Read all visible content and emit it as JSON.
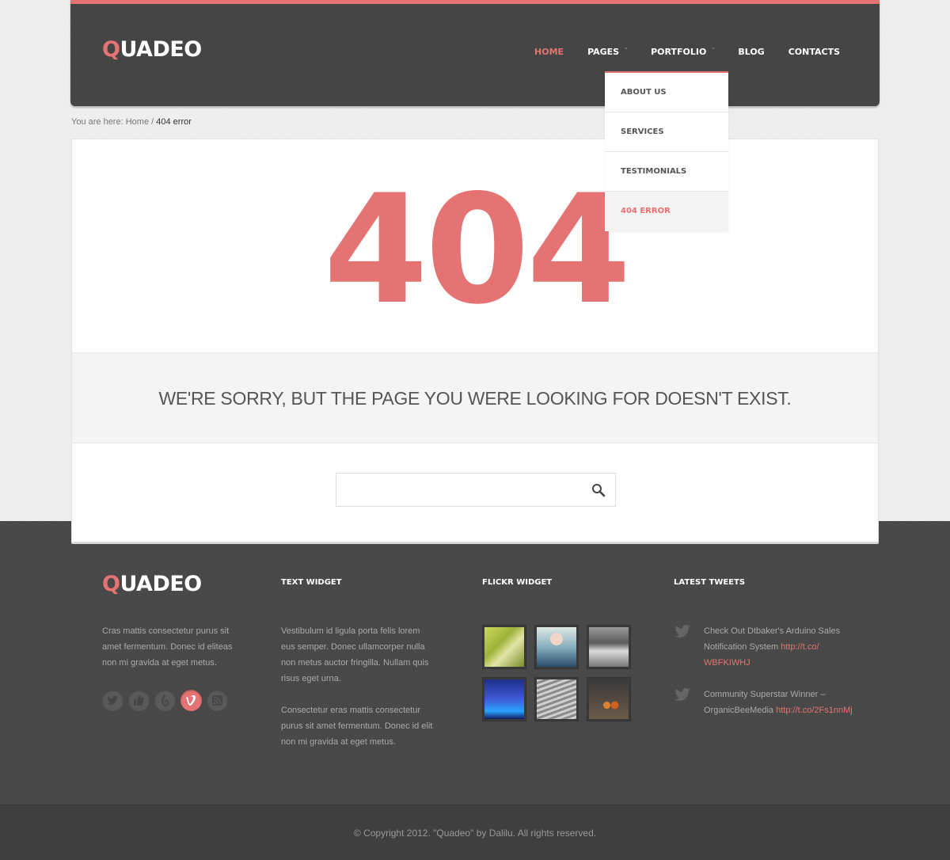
{
  "header": {
    "logo_first": "Q",
    "logo_rest": "UADEO",
    "nav": [
      {
        "label": "HOME"
      },
      {
        "label": "PAGES"
      },
      {
        "label": "PORTFOLIO"
      },
      {
        "label": "BLOG"
      },
      {
        "label": "CONTACTS"
      }
    ],
    "dropdown": [
      {
        "label": "ABOUT US"
      },
      {
        "label": "SERVICES"
      },
      {
        "label": "TESTIMONIALS"
      },
      {
        "label": "404 ERROR"
      }
    ],
    "active_nav": "HOME",
    "accent_color": "#e57373"
  },
  "breadcrumb": {
    "prefix": "You are here:",
    "home": "Home",
    "separator": "/",
    "current": "404 error"
  },
  "main": {
    "error_code": "404",
    "message": "WE'RE SORRY, BUT THE PAGE YOU WERE LOOKING FOR DOESN'T EXIST.",
    "search_placeholder": "",
    "search_icon": "search-icon"
  },
  "footer": {
    "logo_first": "Q",
    "logo_rest": "UADEO",
    "about_text": "Cras mattis consectetur purus sit amet fermentum. Donec id eliteas non mi gravida at eget metus.",
    "social_icons": [
      "twitter-icon",
      "like-icon",
      "dribbble-icon",
      "vimeo-icon",
      "rss-icon"
    ],
    "text_widget": {
      "title": "TEXT WIDGET",
      "para1": "Vestibulum id ligula porta felis lorem eus semper. Donec ullamcorper nulla non metus auctor fringilla. Nullam quis risus eget urna.",
      "para2": "Consectetur eras mattis consectetur purus sit amet fermentum. Donec id elit non mi gravida at eget metus."
    },
    "flickr_widget": {
      "title": "FLICKR WIDGET"
    },
    "tweets": {
      "title": "LATEST TWEETS",
      "items": [
        {
          "text": "Check Out Dtbaker's Arduino Sales Notification System",
          "link": "http://t.co/ WBFKIWHJ"
        },
        {
          "text": "Community Superstar Winner – OrganicBeeMedia",
          "link": "http://t.co/2Fs1nnMj"
        }
      ]
    },
    "copyright": "© Copyright 2012. \"Quadeo\" by Dalilu. All rights reserved."
  }
}
